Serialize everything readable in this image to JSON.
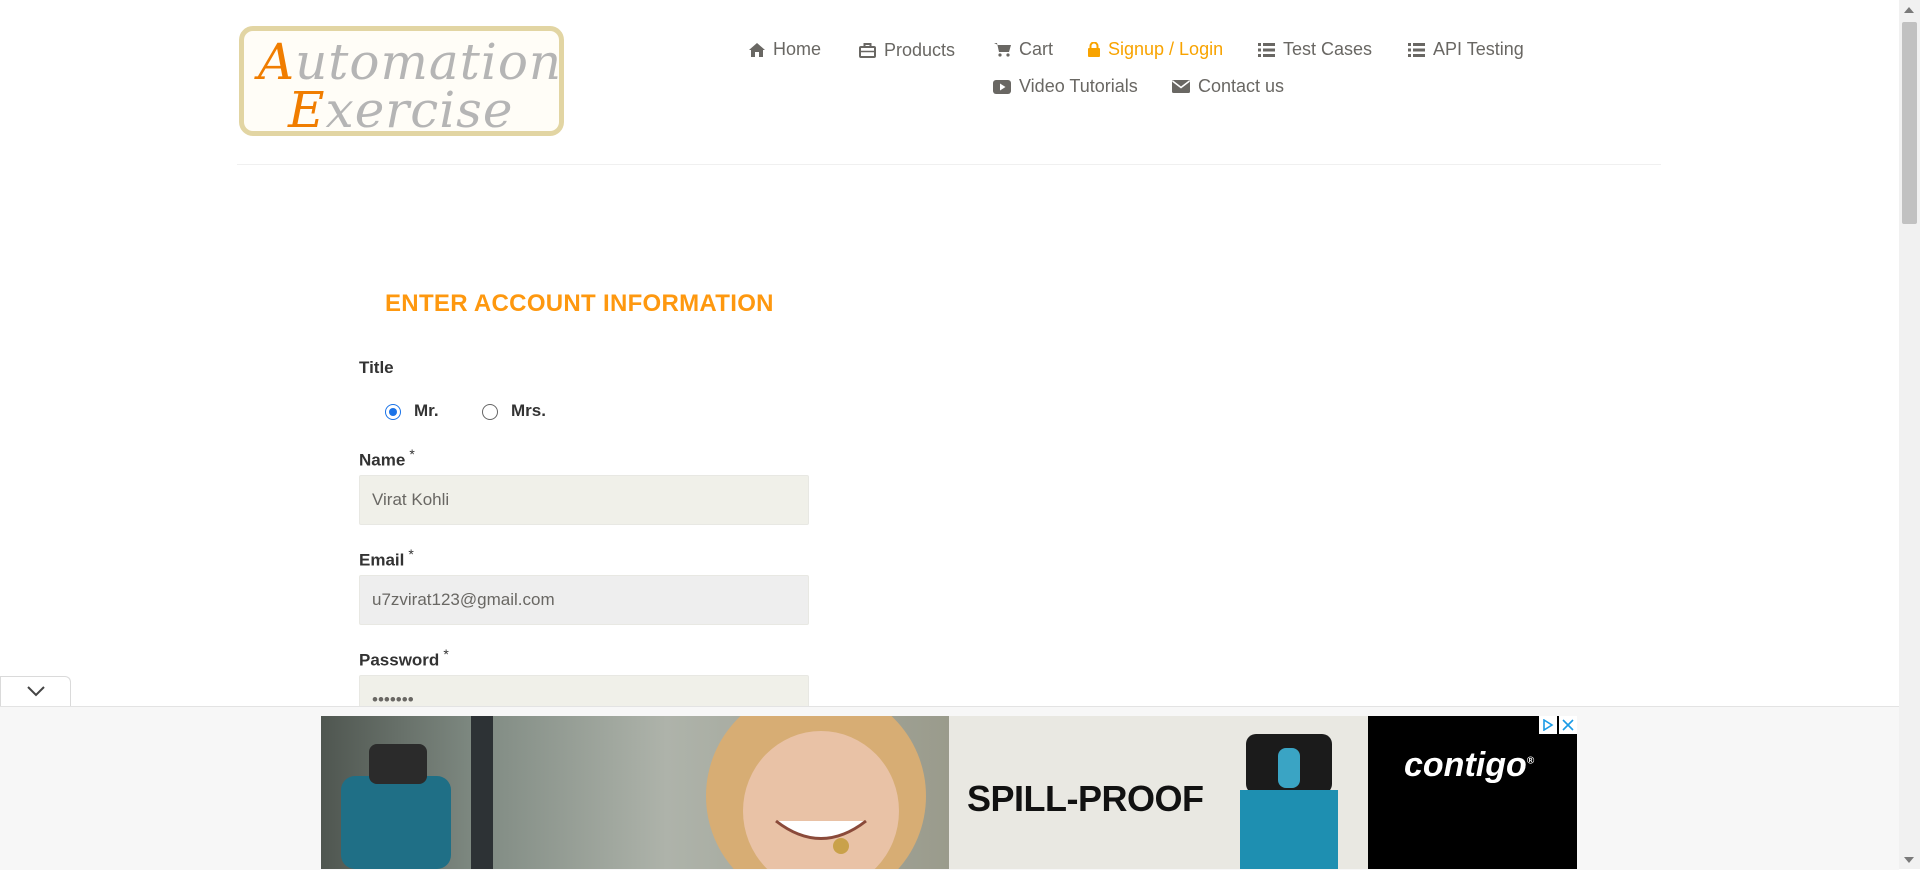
{
  "logo": {
    "line1_cap": "A",
    "line1_rest": "utomation",
    "line2_cap": "E",
    "line2_rest": "xercise"
  },
  "nav": {
    "items": [
      {
        "label": "Home",
        "icon": "home-icon"
      },
      {
        "label": "Products",
        "icon": "briefcase-icon"
      },
      {
        "label": "Cart",
        "icon": "cart-icon"
      },
      {
        "label": "Signup / Login",
        "icon": "lock-icon",
        "active": true
      },
      {
        "label": "Test Cases",
        "icon": "list-icon"
      },
      {
        "label": "API Testing",
        "icon": "list-icon"
      },
      {
        "label": "Video Tutorials",
        "icon": "youtube-play-icon"
      },
      {
        "label": "Contact us",
        "icon": "envelope-icon"
      }
    ],
    "active_color": "#f8a300"
  },
  "form": {
    "heading": "ENTER ACCOUNT INFORMATION",
    "title_label": "Title",
    "title_options": [
      "Mr.",
      "Mrs."
    ],
    "title_selected": "Mr.",
    "name_label": "Name",
    "name_value": "Virat Kohli",
    "email_label": "Email",
    "email_value": "u7zvirat123@gmail.com",
    "password_label": "Password",
    "password_value": "•••••••",
    "required_marker": "*",
    "heading_color": "#fe980f"
  },
  "ad": {
    "headline": "SPILL-PROOF",
    "brand": "contigo",
    "brand_mark": "®"
  }
}
